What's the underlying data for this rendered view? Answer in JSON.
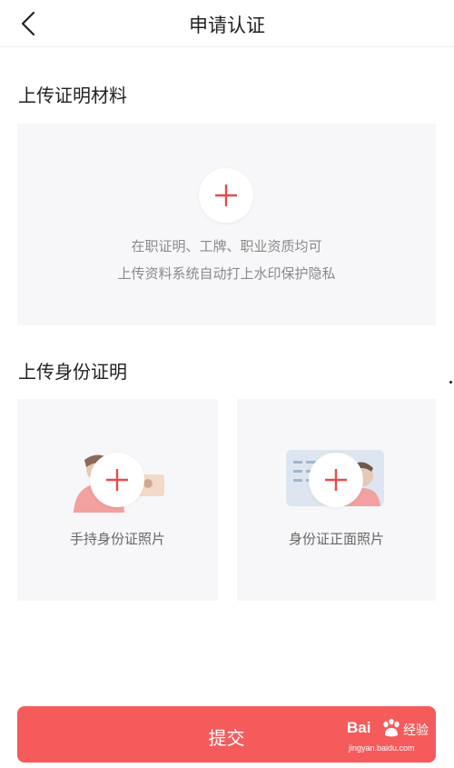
{
  "header": {
    "title": "申请认证",
    "back_icon": "chevron-left-icon"
  },
  "section_materials": {
    "title": "上传证明材料",
    "hint_line1": "在职证明、工牌、职业资质均可",
    "hint_line2": "上传资料系统自动打上水印保护隐私",
    "icon": "plus-icon"
  },
  "section_identity": {
    "title": "上传身份证明",
    "cards": [
      {
        "label": "手持身份证照片",
        "icon": "plus-icon",
        "illustration": "person-holding-id-icon"
      },
      {
        "label": "身份证正面照片",
        "icon": "plus-icon",
        "illustration": "id-card-front-icon"
      }
    ]
  },
  "submit": {
    "label": "提交"
  },
  "watermark": {
    "brand": "Bai",
    "suffix": "经验",
    "url": "jingyan.baidu.com"
  },
  "colors": {
    "accent": "#f55b5b",
    "plus": "#e84a4a",
    "box_bg": "#f7f7f9"
  }
}
